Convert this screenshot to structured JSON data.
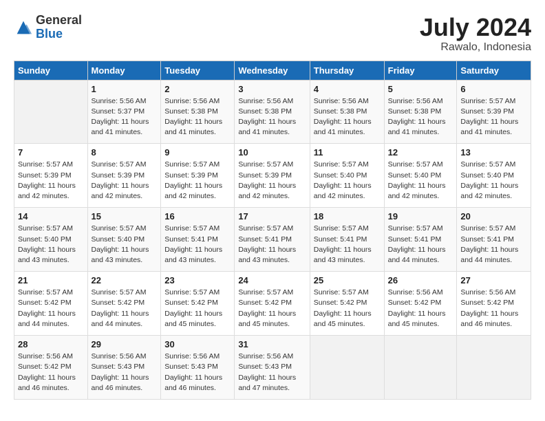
{
  "header": {
    "logo_general": "General",
    "logo_blue": "Blue",
    "month_title": "July 2024",
    "location": "Rawalo, Indonesia"
  },
  "weekdays": [
    "Sunday",
    "Monday",
    "Tuesday",
    "Wednesday",
    "Thursday",
    "Friday",
    "Saturday"
  ],
  "weeks": [
    [
      {
        "day": "",
        "sunrise": "",
        "sunset": "",
        "daylight": ""
      },
      {
        "day": "1",
        "sunrise": "Sunrise: 5:56 AM",
        "sunset": "Sunset: 5:37 PM",
        "daylight": "Daylight: 11 hours and 41 minutes."
      },
      {
        "day": "2",
        "sunrise": "Sunrise: 5:56 AM",
        "sunset": "Sunset: 5:38 PM",
        "daylight": "Daylight: 11 hours and 41 minutes."
      },
      {
        "day": "3",
        "sunrise": "Sunrise: 5:56 AM",
        "sunset": "Sunset: 5:38 PM",
        "daylight": "Daylight: 11 hours and 41 minutes."
      },
      {
        "day": "4",
        "sunrise": "Sunrise: 5:56 AM",
        "sunset": "Sunset: 5:38 PM",
        "daylight": "Daylight: 11 hours and 41 minutes."
      },
      {
        "day": "5",
        "sunrise": "Sunrise: 5:56 AM",
        "sunset": "Sunset: 5:38 PM",
        "daylight": "Daylight: 11 hours and 41 minutes."
      },
      {
        "day": "6",
        "sunrise": "Sunrise: 5:57 AM",
        "sunset": "Sunset: 5:39 PM",
        "daylight": "Daylight: 11 hours and 41 minutes."
      }
    ],
    [
      {
        "day": "7",
        "sunrise": "Sunrise: 5:57 AM",
        "sunset": "Sunset: 5:39 PM",
        "daylight": "Daylight: 11 hours and 42 minutes."
      },
      {
        "day": "8",
        "sunrise": "Sunrise: 5:57 AM",
        "sunset": "Sunset: 5:39 PM",
        "daylight": "Daylight: 11 hours and 42 minutes."
      },
      {
        "day": "9",
        "sunrise": "Sunrise: 5:57 AM",
        "sunset": "Sunset: 5:39 PM",
        "daylight": "Daylight: 11 hours and 42 minutes."
      },
      {
        "day": "10",
        "sunrise": "Sunrise: 5:57 AM",
        "sunset": "Sunset: 5:39 PM",
        "daylight": "Daylight: 11 hours and 42 minutes."
      },
      {
        "day": "11",
        "sunrise": "Sunrise: 5:57 AM",
        "sunset": "Sunset: 5:40 PM",
        "daylight": "Daylight: 11 hours and 42 minutes."
      },
      {
        "day": "12",
        "sunrise": "Sunrise: 5:57 AM",
        "sunset": "Sunset: 5:40 PM",
        "daylight": "Daylight: 11 hours and 42 minutes."
      },
      {
        "day": "13",
        "sunrise": "Sunrise: 5:57 AM",
        "sunset": "Sunset: 5:40 PM",
        "daylight": "Daylight: 11 hours and 42 minutes."
      }
    ],
    [
      {
        "day": "14",
        "sunrise": "Sunrise: 5:57 AM",
        "sunset": "Sunset: 5:40 PM",
        "daylight": "Daylight: 11 hours and 43 minutes."
      },
      {
        "day": "15",
        "sunrise": "Sunrise: 5:57 AM",
        "sunset": "Sunset: 5:40 PM",
        "daylight": "Daylight: 11 hours and 43 minutes."
      },
      {
        "day": "16",
        "sunrise": "Sunrise: 5:57 AM",
        "sunset": "Sunset: 5:41 PM",
        "daylight": "Daylight: 11 hours and 43 minutes."
      },
      {
        "day": "17",
        "sunrise": "Sunrise: 5:57 AM",
        "sunset": "Sunset: 5:41 PM",
        "daylight": "Daylight: 11 hours and 43 minutes."
      },
      {
        "day": "18",
        "sunrise": "Sunrise: 5:57 AM",
        "sunset": "Sunset: 5:41 PM",
        "daylight": "Daylight: 11 hours and 43 minutes."
      },
      {
        "day": "19",
        "sunrise": "Sunrise: 5:57 AM",
        "sunset": "Sunset: 5:41 PM",
        "daylight": "Daylight: 11 hours and 44 minutes."
      },
      {
        "day": "20",
        "sunrise": "Sunrise: 5:57 AM",
        "sunset": "Sunset: 5:41 PM",
        "daylight": "Daylight: 11 hours and 44 minutes."
      }
    ],
    [
      {
        "day": "21",
        "sunrise": "Sunrise: 5:57 AM",
        "sunset": "Sunset: 5:42 PM",
        "daylight": "Daylight: 11 hours and 44 minutes."
      },
      {
        "day": "22",
        "sunrise": "Sunrise: 5:57 AM",
        "sunset": "Sunset: 5:42 PM",
        "daylight": "Daylight: 11 hours and 44 minutes."
      },
      {
        "day": "23",
        "sunrise": "Sunrise: 5:57 AM",
        "sunset": "Sunset: 5:42 PM",
        "daylight": "Daylight: 11 hours and 45 minutes."
      },
      {
        "day": "24",
        "sunrise": "Sunrise: 5:57 AM",
        "sunset": "Sunset: 5:42 PM",
        "daylight": "Daylight: 11 hours and 45 minutes."
      },
      {
        "day": "25",
        "sunrise": "Sunrise: 5:57 AM",
        "sunset": "Sunset: 5:42 PM",
        "daylight": "Daylight: 11 hours and 45 minutes."
      },
      {
        "day": "26",
        "sunrise": "Sunrise: 5:56 AM",
        "sunset": "Sunset: 5:42 PM",
        "daylight": "Daylight: 11 hours and 45 minutes."
      },
      {
        "day": "27",
        "sunrise": "Sunrise: 5:56 AM",
        "sunset": "Sunset: 5:42 PM",
        "daylight": "Daylight: 11 hours and 46 minutes."
      }
    ],
    [
      {
        "day": "28",
        "sunrise": "Sunrise: 5:56 AM",
        "sunset": "Sunset: 5:42 PM",
        "daylight": "Daylight: 11 hours and 46 minutes."
      },
      {
        "day": "29",
        "sunrise": "Sunrise: 5:56 AM",
        "sunset": "Sunset: 5:43 PM",
        "daylight": "Daylight: 11 hours and 46 minutes."
      },
      {
        "day": "30",
        "sunrise": "Sunrise: 5:56 AM",
        "sunset": "Sunset: 5:43 PM",
        "daylight": "Daylight: 11 hours and 46 minutes."
      },
      {
        "day": "31",
        "sunrise": "Sunrise: 5:56 AM",
        "sunset": "Sunset: 5:43 PM",
        "daylight": "Daylight: 11 hours and 47 minutes."
      },
      {
        "day": "",
        "sunrise": "",
        "sunset": "",
        "daylight": ""
      },
      {
        "day": "",
        "sunrise": "",
        "sunset": "",
        "daylight": ""
      },
      {
        "day": "",
        "sunrise": "",
        "sunset": "",
        "daylight": ""
      }
    ]
  ]
}
